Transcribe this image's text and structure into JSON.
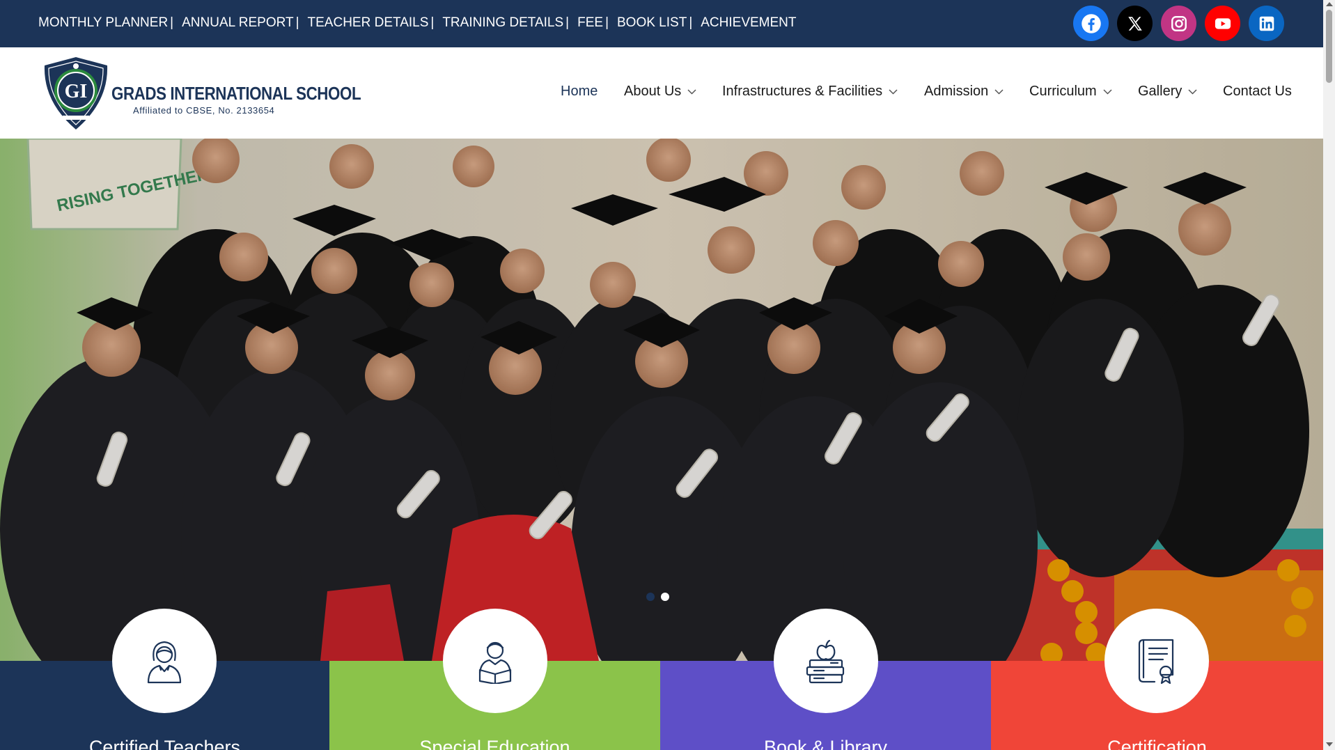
{
  "top_links": [
    {
      "label": "MONTHLY PLANNER"
    },
    {
      "label": "ANNUAL REPORT"
    },
    {
      "label": "TEACHER DETAILS"
    },
    {
      "label": "TRAINING DETAILS"
    },
    {
      "label": "FEE"
    },
    {
      "label": "BOOK LIST"
    },
    {
      "label": "ACHIEVEMENT"
    }
  ],
  "separator": "|",
  "social": [
    {
      "icon": "facebook-icon",
      "color": "#1877f2"
    },
    {
      "icon": "x-twitter-icon",
      "color": "#000000"
    },
    {
      "icon": "instagram-icon",
      "color": "#c13584"
    },
    {
      "icon": "youtube-icon",
      "color": "#ff0000"
    },
    {
      "icon": "linkedin-icon",
      "color": "#0a66c2"
    }
  ],
  "brand": {
    "name": "GRADS INTERNATIONAL SCHOOL",
    "affiliation": "Affiliated to CBSE, No. 2133654",
    "emblem_letters": "GI",
    "color": "#1c3458"
  },
  "nav": [
    {
      "label": "Home",
      "dropdown": false,
      "active": true
    },
    {
      "label": "About Us",
      "dropdown": true
    },
    {
      "label": "Infrastructures & Facilities",
      "dropdown": true
    },
    {
      "label": "Admission",
      "dropdown": true
    },
    {
      "label": "Curriculum",
      "dropdown": true
    },
    {
      "label": "Gallery",
      "dropdown": true
    },
    {
      "label": "Contact Us",
      "dropdown": false
    }
  ],
  "hero": {
    "banner_text": "RISING TOGETHER",
    "slide_count": 2,
    "active_slide": 2
  },
  "features": [
    {
      "title": "Certified Teachers",
      "icon": "teacher-icon",
      "color": "#1c3458"
    },
    {
      "title": "Special Education",
      "icon": "student-reading-icon",
      "color": "#8bc34a"
    },
    {
      "title": "Book & Library",
      "icon": "books-apple-icon",
      "color": "#5e4fc7"
    },
    {
      "title": "Certification",
      "icon": "certificate-icon",
      "color": "#f04538"
    }
  ],
  "colors": {
    "topbar": "#1c3458",
    "text_dark": "#1a1a1a"
  }
}
